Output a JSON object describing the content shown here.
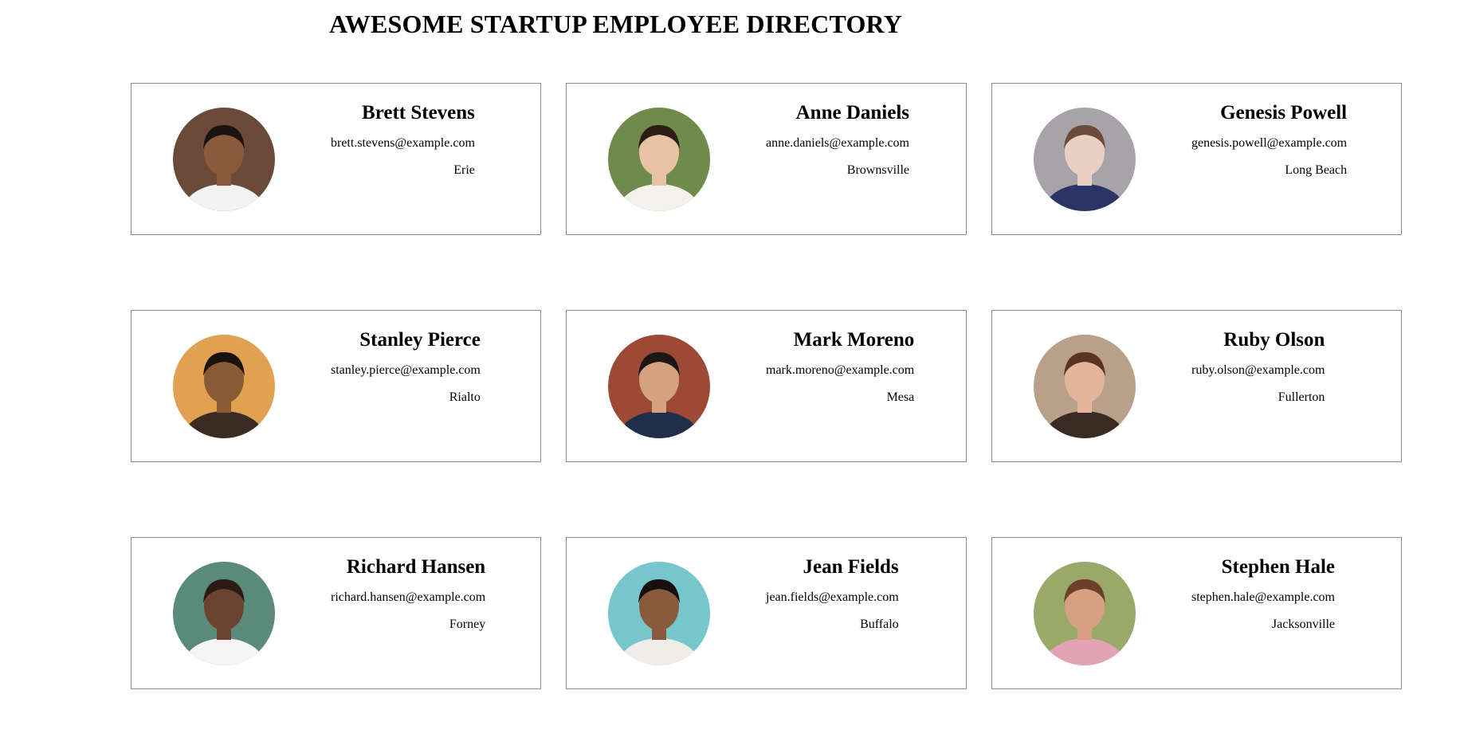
{
  "page": {
    "title": "AWESOME STARTUP EMPLOYEE DIRECTORY"
  },
  "employees": [
    {
      "name": "Brett Stevens",
      "email": "brett.stevens@example.com",
      "city": "Erie",
      "photo": {
        "bg": "#6b4a3a",
        "skin": "#8a5a3c",
        "hair": "#1a1410",
        "shirt": "#f2f2f2"
      }
    },
    {
      "name": "Anne Daniels",
      "email": "anne.daniels@example.com",
      "city": "Brownsville",
      "photo": {
        "bg": "#6f8a4a",
        "skin": "#e8c2a4",
        "hair": "#2b1c14",
        "shirt": "#f4f1ec"
      }
    },
    {
      "name": "Genesis Powell",
      "email": "genesis.powell@example.com",
      "city": "Long Beach",
      "photo": {
        "bg": "#a7a3a8",
        "skin": "#ead0c2",
        "hair": "#6a4a38",
        "shirt": "#2a3566"
      }
    },
    {
      "name": "Stanley Pierce",
      "email": "stanley.pierce@example.com",
      "city": "Rialto",
      "photo": {
        "bg": "#e0a152",
        "skin": "#8a5a34",
        "hair": "#1a120c",
        "shirt": "#3a2c22"
      }
    },
    {
      "name": "Mark Moreno",
      "email": "mark.moreno@example.com",
      "city": "Mesa",
      "photo": {
        "bg": "#9c4a36",
        "skin": "#d4a27e",
        "hair": "#1e1612",
        "shirt": "#1f2f4a"
      }
    },
    {
      "name": "Ruby Olson",
      "email": "ruby.olson@example.com",
      "city": "Fullerton",
      "photo": {
        "bg": "#b8a08a",
        "skin": "#e3b59a",
        "hair": "#5a3322",
        "shirt": "#3a2a22"
      }
    },
    {
      "name": "Richard Hansen",
      "email": "richard.hansen@example.com",
      "city": "Forney",
      "photo": {
        "bg": "#5b8a7a",
        "skin": "#6a4430",
        "hair": "#2a1c14",
        "shirt": "#f5f5f5"
      }
    },
    {
      "name": "Jean Fields",
      "email": "jean.fields@example.com",
      "city": "Buffalo",
      "photo": {
        "bg": "#76c6cc",
        "skin": "#8a5a3e",
        "hair": "#161010",
        "shirt": "#f0ede8"
      }
    },
    {
      "name": "Stephen Hale",
      "email": "stephen.hale@example.com",
      "city": "Jacksonville",
      "photo": {
        "bg": "#9aa86a",
        "skin": "#d4a080",
        "hair": "#6a4028",
        "shirt": "#e2a4b4"
      }
    }
  ]
}
